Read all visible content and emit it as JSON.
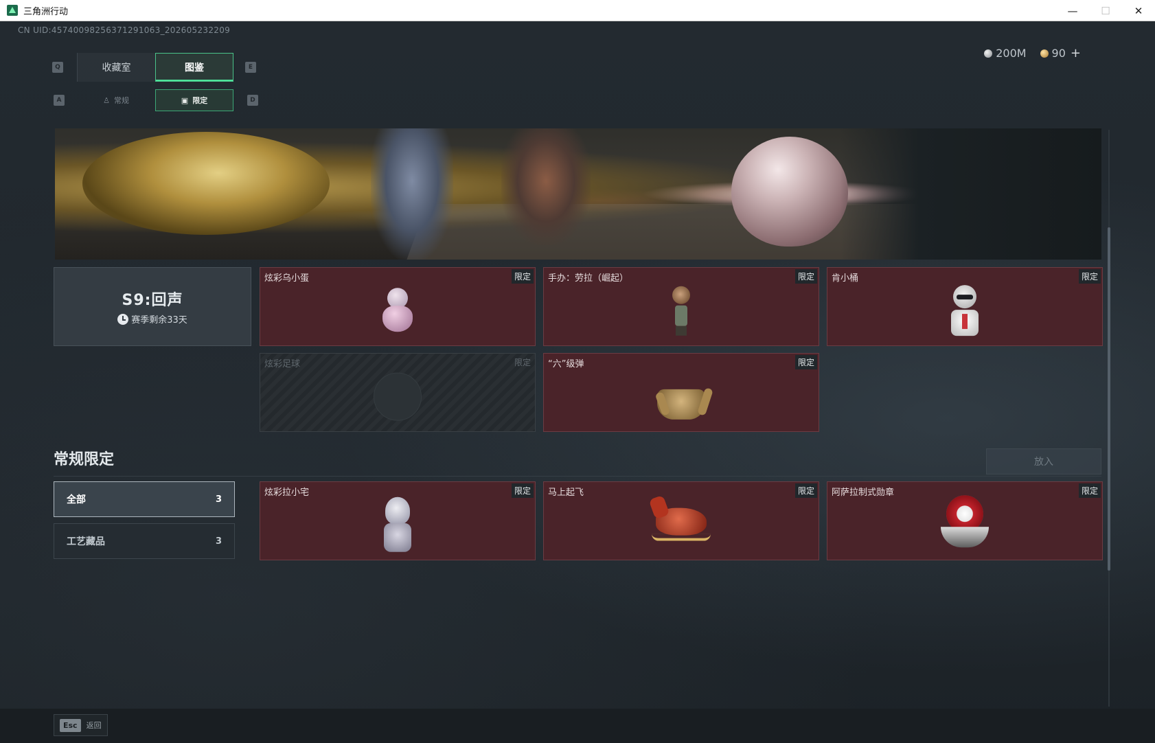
{
  "window": {
    "title": "三角洲行动",
    "minimize": "—",
    "maximize": "☐",
    "close": "✕"
  },
  "uid": "CN UID:457400982563712910​63_202605232209",
  "currency": {
    "silver": "200M",
    "gold": "90",
    "plus": "+"
  },
  "tabs": {
    "prev_key": "Q",
    "next_key": "E",
    "items": [
      {
        "label": "收藏室",
        "active": false
      },
      {
        "label": "图鉴",
        "active": true
      }
    ]
  },
  "subtabs": {
    "prev_key": "A",
    "next_key": "D",
    "items": [
      {
        "label": "常规",
        "icon": "figure-icon",
        "active": false
      },
      {
        "label": "限定",
        "icon": "image-icon",
        "active": true
      }
    ]
  },
  "season": {
    "title": "S9:回声",
    "remaining": "赛季剩余33天"
  },
  "season_items": [
    {
      "name": "炫彩乌小蛋",
      "tag": "限定",
      "locked": false,
      "figure": "egg"
    },
    {
      "name": "手办：劳拉（崛起）",
      "tag": "限定",
      "locked": false,
      "figure": "lara"
    },
    {
      "name": "肯小桶",
      "tag": "限定",
      "locked": false,
      "figure": "ken"
    },
    {
      "name": "炫彩足球",
      "tag": "限定",
      "locked": true,
      "figure": "none"
    },
    {
      "name": "“六”级弹",
      "tag": "限定",
      "locked": false,
      "figure": "hand"
    }
  ],
  "section": {
    "title": "常规限定",
    "put_button": "放入"
  },
  "filters": [
    {
      "label": "全部",
      "count": "3",
      "active": true
    },
    {
      "label": "工艺藏品",
      "count": "3",
      "active": false
    }
  ],
  "regular_items": [
    {
      "name": "炫彩拉小宅",
      "tag": "限定",
      "figure": "otaku"
    },
    {
      "name": "马上起飞",
      "tag": "限定",
      "figure": "horse"
    },
    {
      "name": "阿萨拉制式勋章",
      "tag": "限定",
      "figure": "medal"
    }
  ],
  "footer": {
    "esc_key": "Esc",
    "back_label": "返回"
  }
}
